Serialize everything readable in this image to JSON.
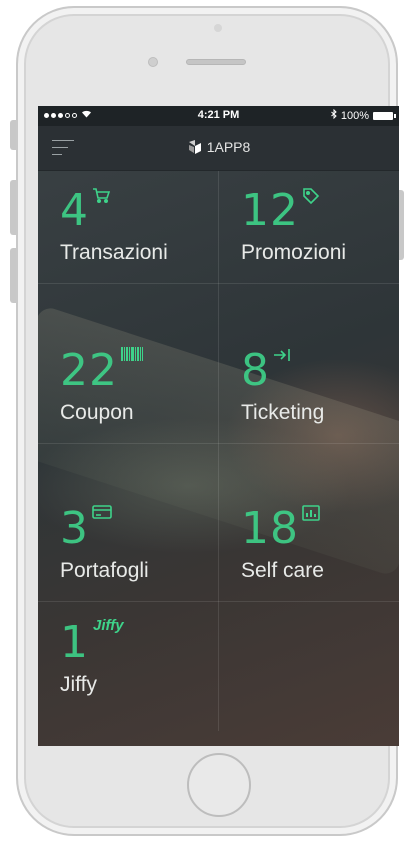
{
  "status_bar": {
    "time": "4:21 PM",
    "battery": "100%",
    "signal_icon": "signal-dots-icon",
    "wifi_icon": "wifi-icon",
    "bluetooth_icon": "bluetooth-icon"
  },
  "header": {
    "brand": "1APP8",
    "menu_icon": "hamburger-menu-icon"
  },
  "colors": {
    "accent": "#3ed38a",
    "navbar": "#2b3034",
    "statusbar": "#1e2326"
  },
  "tiles": [
    {
      "count": "4",
      "label": "Transazioni",
      "icon": "cart-icon"
    },
    {
      "count": "12",
      "label": "Promozioni",
      "icon": "tag-icon"
    },
    {
      "count": "22",
      "label": "Coupon",
      "icon": "barcode-icon"
    },
    {
      "count": "8",
      "label": "Ticketing",
      "icon": "ticket-arrow-icon"
    },
    {
      "count": "3",
      "label": "Portafogli",
      "icon": "card-icon"
    },
    {
      "count": "18",
      "label": "Self care",
      "icon": "chart-icon"
    },
    {
      "count": "1",
      "label": "Jiffy",
      "icon": "jiffy-logo",
      "logo_text": "Jiffy"
    }
  ]
}
